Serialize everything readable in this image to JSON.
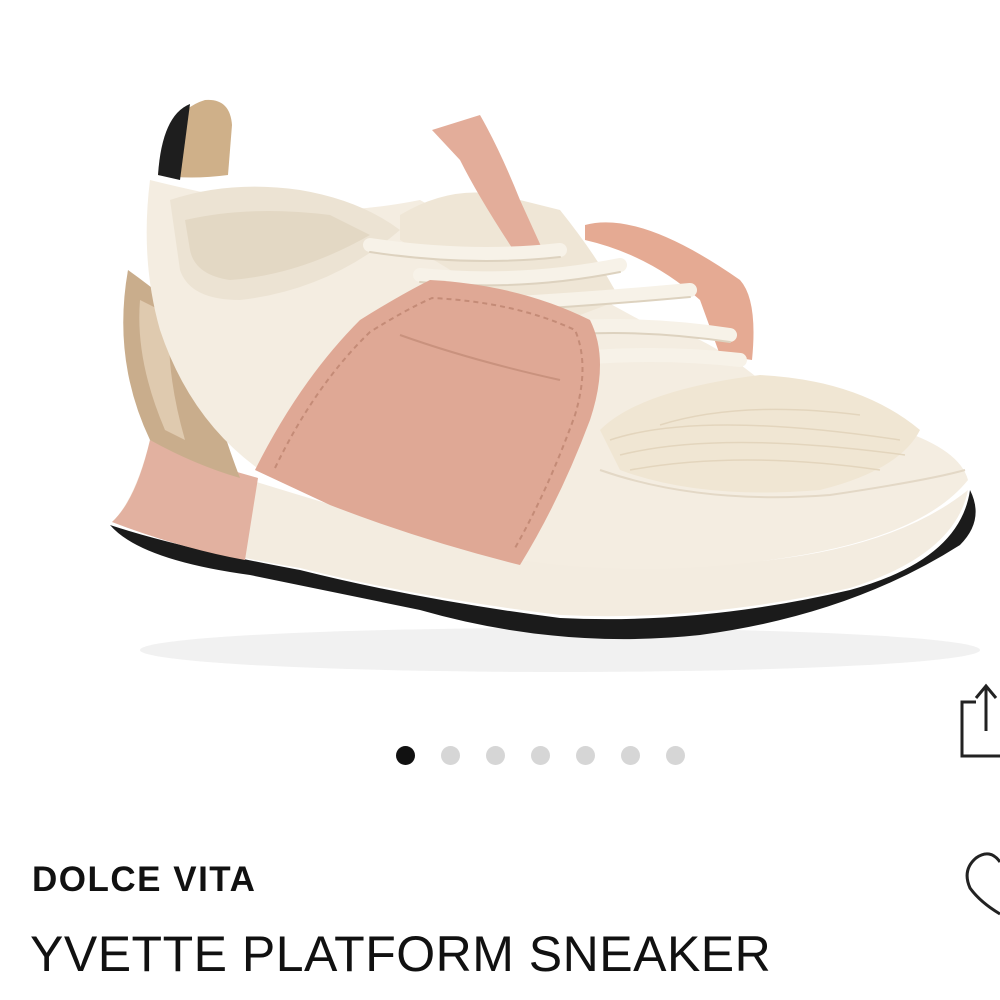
{
  "product": {
    "brand": "DOLCE VITA",
    "name": "YVETTE PLATFORM SNEAKER"
  },
  "carousel": {
    "total_images": 7,
    "active_index": 0
  },
  "icons": {
    "share": "share-icon",
    "wishlist": "heart-icon"
  },
  "colors": {
    "active_dot": "#111111",
    "inactive_dot": "#d6d6d6"
  }
}
